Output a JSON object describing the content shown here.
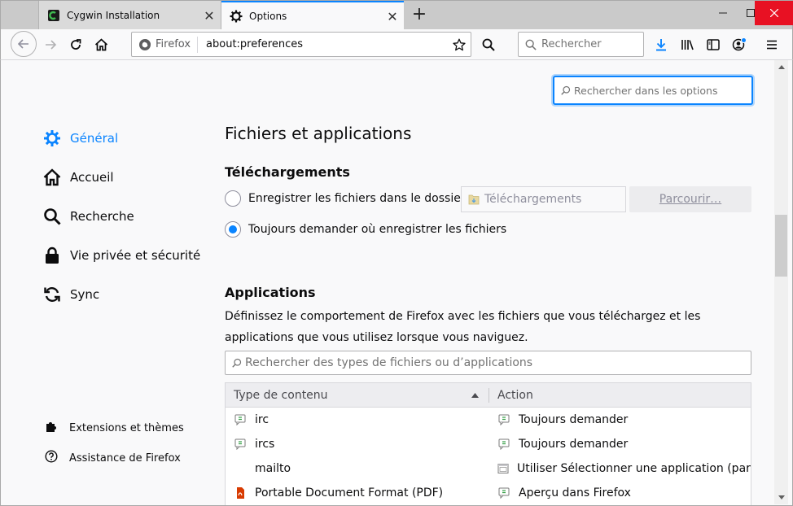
{
  "tabs": [
    {
      "title": "Cygwin Installation",
      "active": false
    },
    {
      "title": "Options",
      "active": true
    }
  ],
  "navbar": {
    "identity_label": "Firefox",
    "url": "about:preferences",
    "search_placeholder": "Rechercher"
  },
  "prefs": {
    "search_placeholder": "Rechercher dans les options",
    "categories": [
      {
        "label": "Général",
        "icon": "gear-icon",
        "selected": true
      },
      {
        "label": "Accueil",
        "icon": "home-icon",
        "selected": false
      },
      {
        "label": "Recherche",
        "icon": "search-icon",
        "selected": false
      },
      {
        "label": "Vie privée et sécurité",
        "icon": "lock-icon",
        "selected": false
      },
      {
        "label": "Sync",
        "icon": "sync-icon",
        "selected": false
      }
    ],
    "footer_links": [
      {
        "label": "Extensions et thèmes",
        "icon": "puzzle-icon"
      },
      {
        "label": "Assistance de Firefox",
        "icon": "help-icon"
      }
    ],
    "section_title": "Fichiers et applications",
    "downloads": {
      "heading": "Téléchargements",
      "option_save": "Enregistrer les fichiers dans le dossier",
      "option_ask": "Toujours demander où enregistrer les fichiers",
      "folder_value": "Téléchargements",
      "browse_label": "Parcourir…",
      "selected": "ask"
    },
    "applications": {
      "heading": "Applications",
      "description": "Définissez le comportement de Firefox avec les fichiers que vous téléchargez et les applications que vous utilisez lorsque vous naviguez.",
      "search_placeholder": "Rechercher des types de fichiers ou d’applications",
      "col_type": "Type de contenu",
      "col_action": "Action",
      "rows": [
        {
          "type": "irc",
          "type_icon": "chat-icon",
          "action": "Toujours demander",
          "action_icon": "chat-icon"
        },
        {
          "type": "ircs",
          "type_icon": "chat-icon",
          "action": "Toujours demander",
          "action_icon": "chat-icon"
        },
        {
          "type": "mailto",
          "type_icon": "",
          "action": "Utiliser Sélectionner une application (par …",
          "action_icon": "app-icon"
        },
        {
          "type": "Portable Document Format (PDF)",
          "type_icon": "pdf-icon",
          "action": "Aperçu dans Firefox",
          "action_icon": "chat-icon"
        }
      ]
    }
  },
  "colors": {
    "accent": "#0a84ff",
    "close_button": "#e81123"
  }
}
